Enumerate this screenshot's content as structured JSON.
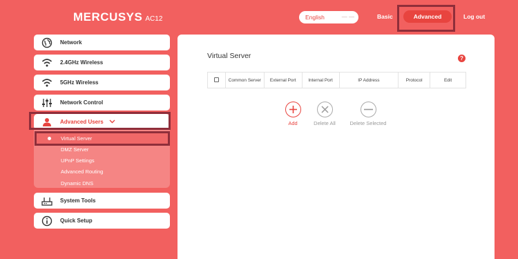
{
  "header": {
    "brand": "MERCUSYS",
    "model": "AC12",
    "language": "English",
    "nav": {
      "basic": "Basic",
      "advanced": "Advanced",
      "logout": "Log out"
    }
  },
  "sidebar": {
    "items": [
      {
        "label": "Network",
        "icon": "globe-icon"
      },
      {
        "label": "2.4GHz Wireless",
        "icon": "wifi-icon"
      },
      {
        "label": "5GHz Wireless",
        "icon": "wifi-icon"
      },
      {
        "label": "Network Control",
        "icon": "sliders-icon"
      },
      {
        "label": "Advanced Users",
        "icon": "user-icon"
      },
      {
        "label": "System Tools",
        "icon": "router-icon"
      },
      {
        "label": "Quick Setup",
        "icon": "info-icon"
      }
    ],
    "submenu": [
      {
        "label": "Virtual Server"
      },
      {
        "label": "DMZ Server"
      },
      {
        "label": "UPnP Settings"
      },
      {
        "label": "Advanced Routing"
      },
      {
        "label": "Dynamic DNS"
      }
    ]
  },
  "main": {
    "title": "Virtual Server",
    "help": "?",
    "table_headers": [
      "Common Server",
      "External Port",
      "Internal Port",
      "IP Address",
      "Protocol",
      "Edit"
    ],
    "actions": {
      "add": "Add",
      "delete_all": "Delete All",
      "delete_selected": "Delete Selected"
    }
  },
  "colors": {
    "background": "#f2605f",
    "accent": "#e8443f",
    "highlight_frame": "#8f2e3a",
    "submenu_bg": "#f58584"
  }
}
